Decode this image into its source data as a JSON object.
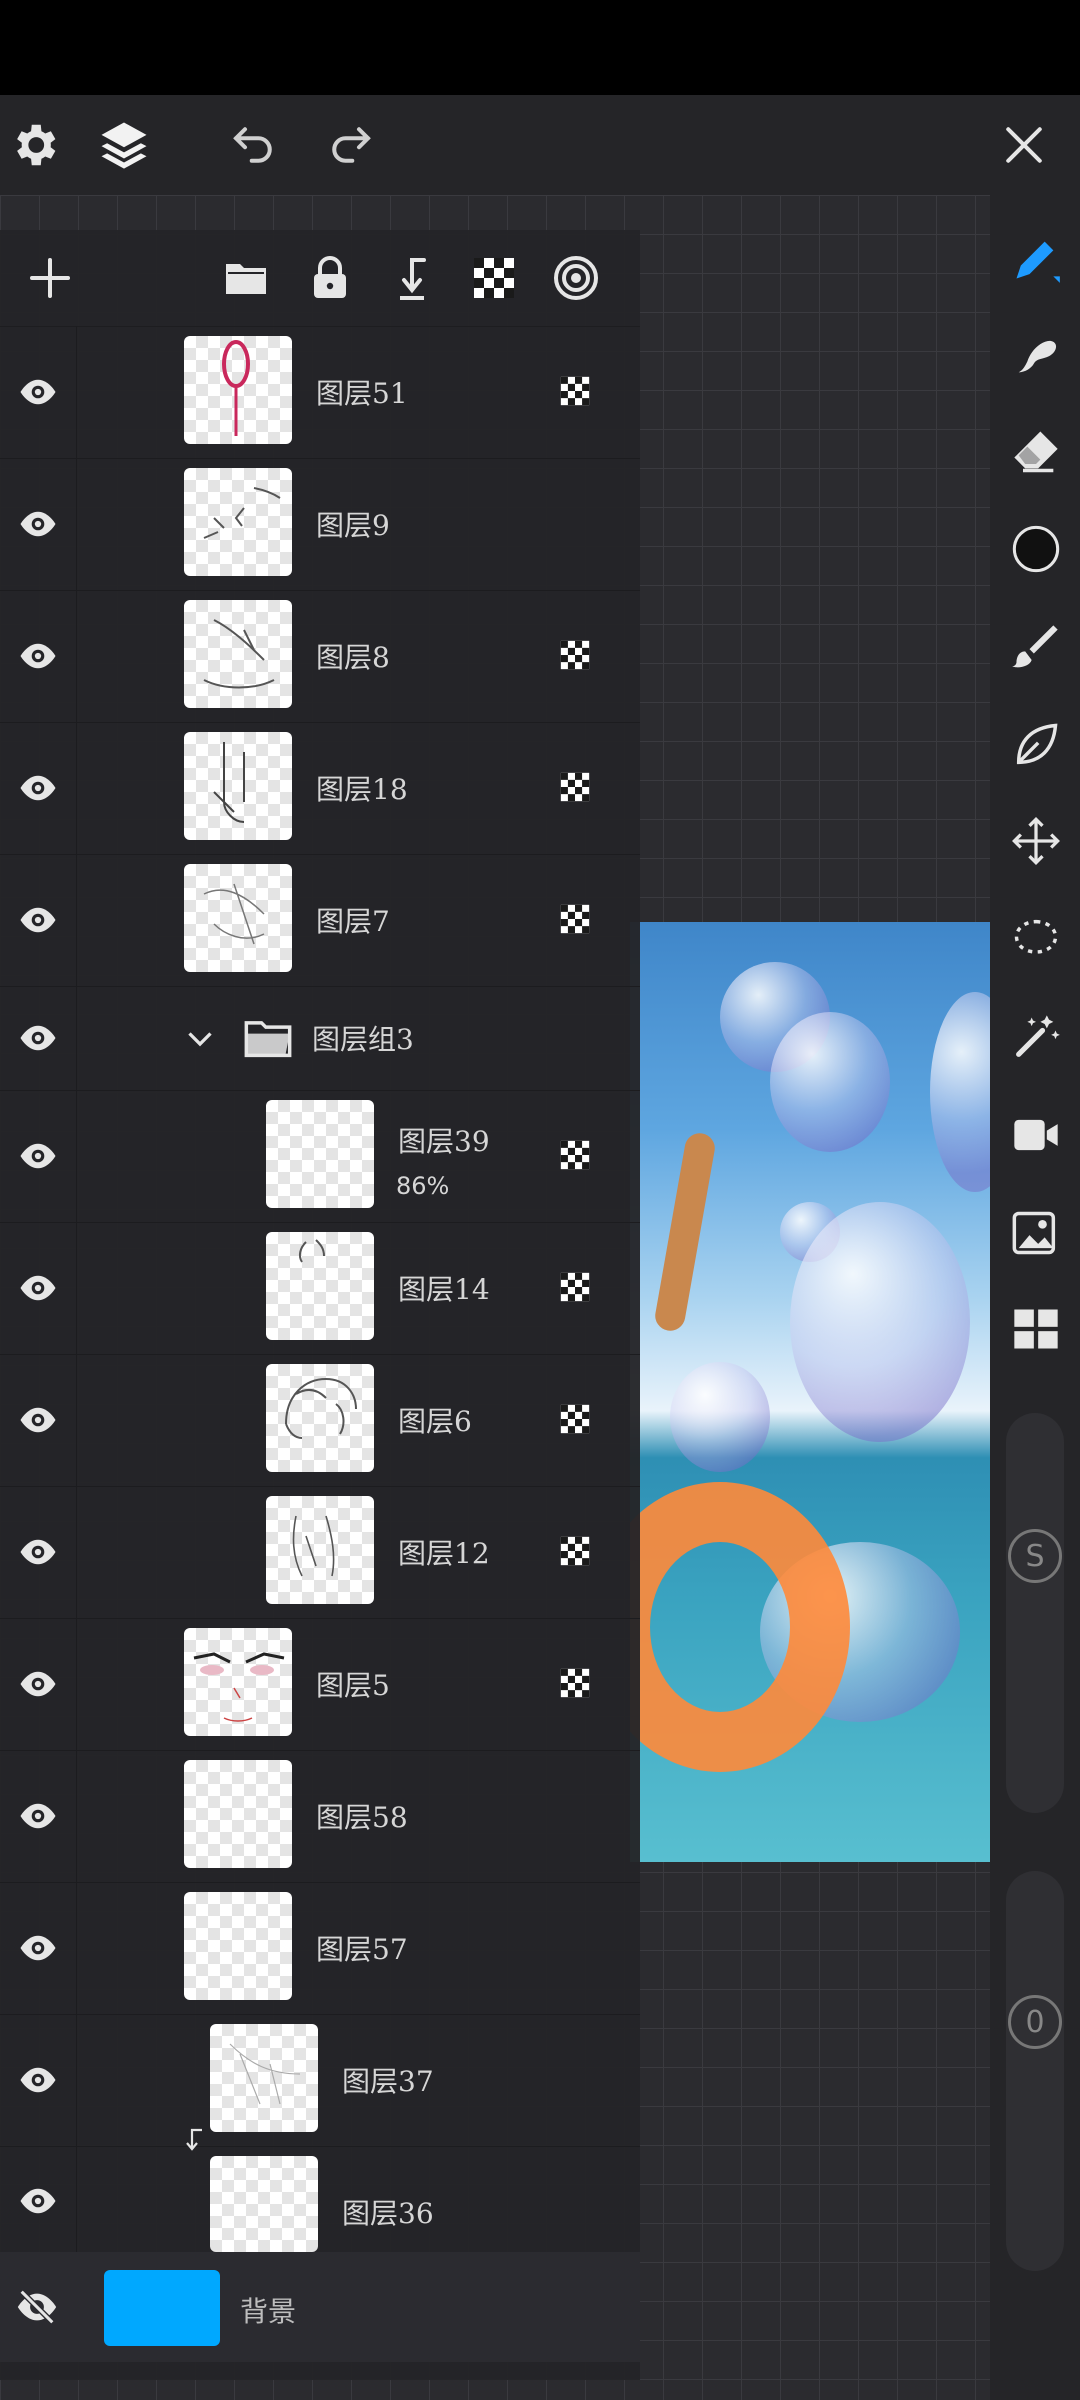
{
  "toolbar": {
    "icons": [
      "settings-icon",
      "layers-icon",
      "undo-icon",
      "redo-icon",
      "close-icon"
    ]
  },
  "layer_panel": {
    "toolbar_icons": [
      "add-layer-icon",
      "folder-icon",
      "lock-icon",
      "merge-down-icon",
      "alpha-lock-icon",
      "clipping-icon"
    ],
    "layers": [
      {
        "name": "图层51",
        "alpha_lock": true
      },
      {
        "name": "图层9",
        "alpha_lock": false
      },
      {
        "name": "图层8",
        "alpha_lock": true
      },
      {
        "name": "图层18",
        "alpha_lock": true
      },
      {
        "name": "图层7",
        "alpha_lock": true
      },
      {
        "name": "图层组3",
        "is_group": true,
        "expanded": true
      },
      {
        "name": "图层39",
        "opacity": "86%",
        "alpha_lock": true
      },
      {
        "name": "图层14",
        "alpha_lock": true
      },
      {
        "name": "图层6",
        "alpha_lock": true
      },
      {
        "name": "图层12",
        "alpha_lock": true
      },
      {
        "name": "图层5",
        "alpha_lock": true
      },
      {
        "name": "图层58",
        "alpha_lock": false
      },
      {
        "name": "图层57",
        "alpha_lock": false
      },
      {
        "name": "图层37",
        "alpha_lock": false,
        "clipped": true
      },
      {
        "name": "图层36",
        "alpha_lock": false
      }
    ],
    "background": {
      "name": "背景",
      "color": "#00a8ff",
      "visible": false
    }
  },
  "right_tools": {
    "icons": [
      "pen-icon",
      "smudge-icon",
      "eraser-icon",
      "color-icon",
      "brush-icon",
      "leaf-icon",
      "move-icon",
      "lasso-icon",
      "magic-wand-icon",
      "video-icon",
      "image-icon",
      "grid-icon"
    ],
    "size_label": "S",
    "opacity_label": "0"
  },
  "colors": {
    "accent": "#1e9bff",
    "panel": "#242428",
    "background_swatch": "#00a8ff"
  }
}
